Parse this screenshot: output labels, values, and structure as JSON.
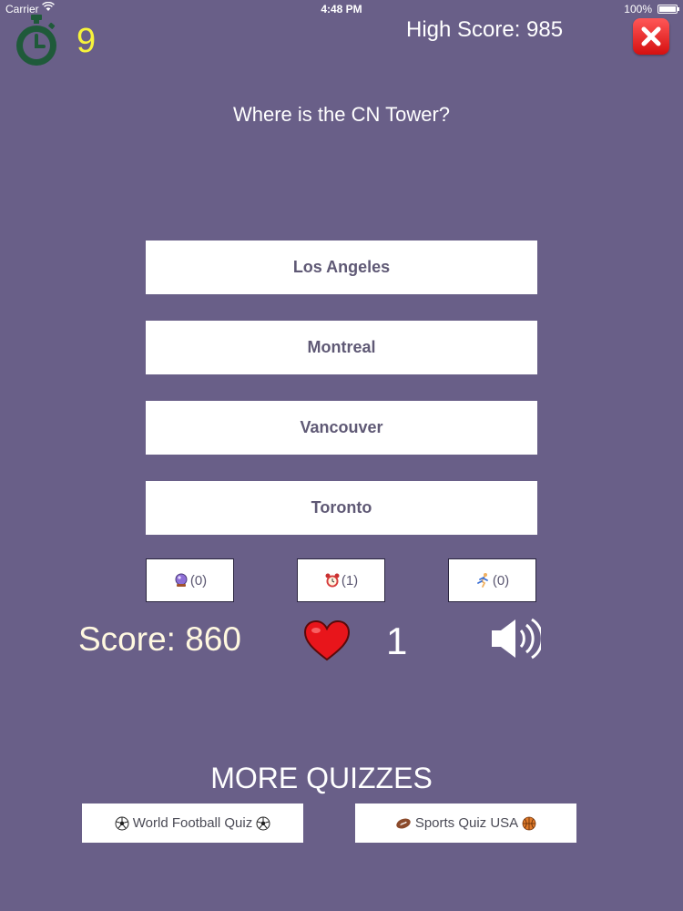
{
  "status_bar": {
    "carrier": "Carrier",
    "time": "4:48 PM",
    "battery": "100%"
  },
  "hud": {
    "timer_count": "9",
    "high_score": "High Score: 985"
  },
  "question": "Where is the CN Tower?",
  "answers": [
    "Los Angeles",
    "Montreal",
    "Vancouver",
    "Toronto"
  ],
  "lifelines": [
    {
      "icon": "crystal-ball-icon",
      "count": "(0)"
    },
    {
      "icon": "alarm-clock-icon",
      "count": "(1)"
    },
    {
      "icon": "runner-icon",
      "count": "(0)"
    }
  ],
  "score": "Score: 860",
  "lives": "1",
  "more_quizzes": {
    "heading": "MORE QUIZZES",
    "items": [
      {
        "label": "World Football Quiz",
        "icons": [
          "soccer-ball-icon",
          "soccer-ball-icon"
        ]
      },
      {
        "label": "Sports Quiz USA",
        "icons": [
          "american-football-icon",
          "basketball-icon"
        ]
      }
    ]
  },
  "colors": {
    "background": "#695f88",
    "timer": "#f7f33b",
    "timer_icon": "#1f5a3a",
    "close": "#e11d1d",
    "heart": "#e8151b"
  }
}
